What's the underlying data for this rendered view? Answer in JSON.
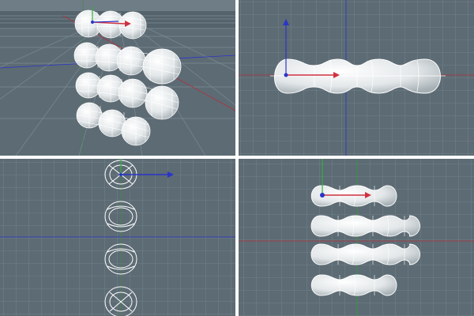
{
  "viewports": [
    {
      "view": "perspective",
      "object_rows": [
        3,
        4,
        4,
        3
      ]
    },
    {
      "view": "top",
      "object_rows": [
        4
      ]
    },
    {
      "view": "right",
      "object_rows": [
        1,
        1,
        1,
        1
      ]
    },
    {
      "view": "front",
      "object_rows": [
        3,
        4,
        4,
        3
      ]
    }
  ],
  "colors": {
    "viewport_bg": "#5d6b74",
    "grid_line": "#768790",
    "axis_x": "#b0303a",
    "axis_y": "#2f9a3a",
    "axis_z": "#2a35c8",
    "separator": "#ffffff",
    "sphere_fill": "#e8eced",
    "sphere_wire": "#ffffff"
  }
}
